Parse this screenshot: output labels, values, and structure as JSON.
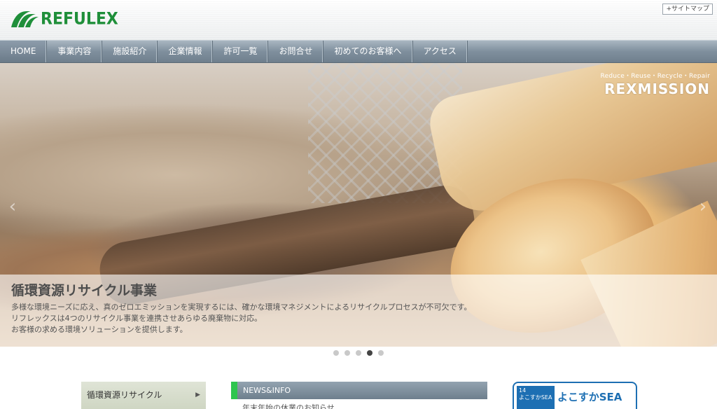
{
  "header": {
    "logo_text": "REFULEX",
    "sitemap_label": "+サイトマップ",
    "brand_color": "#1f8f3a"
  },
  "nav": {
    "items": [
      {
        "label": "HOME"
      },
      {
        "label": "事業内容"
      },
      {
        "label": "施設紹介"
      },
      {
        "label": "企業情報"
      },
      {
        "label": "許可一覧"
      },
      {
        "label": "お問合せ"
      },
      {
        "label": "初めてのお客様へ"
      },
      {
        "label": "アクセス"
      }
    ]
  },
  "hero": {
    "badge_tagline": "Reduce・Reuse・Recycle・Repair",
    "badge_name": "REXMISSION",
    "caption_title": "循環資源リサイクル事業",
    "caption_lines": [
      "多様な環境ニーズに応え、真のゼロエミッションを実現するには、確かな環境マネジメントによるリサイクルプロセスが不可欠です。",
      "リフレックスは4つのリサイクル事業を連携させあらゆる廃棄物に対応。",
      "お客様の求める環境ソリューションを提供します。"
    ],
    "prev_icon": "chevron-left-icon",
    "next_icon": "chevron-right-icon",
    "slides_total": 5,
    "slide_active": 4
  },
  "sidebar": {
    "items": [
      {
        "label": "循環資源リサイクル"
      }
    ]
  },
  "news": {
    "header_label": "NEWS&INFO",
    "accent_color": "#2fc54f",
    "items": [
      {
        "label": "年末年始の休業のお知らせ"
      }
    ]
  },
  "banner": {
    "badge_number": "14",
    "badge_text": "よこすかSEA",
    "title": "よこすかSEA",
    "color": "#1d6fb3"
  }
}
